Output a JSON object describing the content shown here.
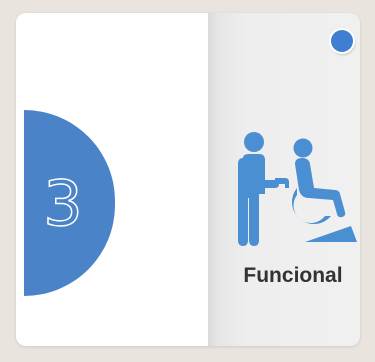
{
  "step": {
    "number": "3",
    "accent_color": "#4a83c8"
  },
  "category": {
    "label": "Funcional",
    "icon": "caregiver-wheelchair-icon",
    "icon_color": "#4a8fd1"
  },
  "indicator": {
    "color": "#3f7ed0"
  }
}
